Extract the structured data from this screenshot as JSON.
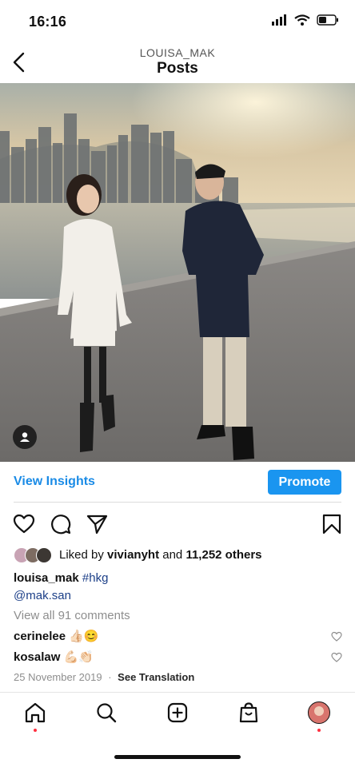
{
  "status": {
    "time": "16:16"
  },
  "header": {
    "username": "LOUISA_MAK",
    "title": "Posts"
  },
  "post": {
    "insights_label": "View Insights",
    "promote_label": "Promote",
    "likes": {
      "prefix": "Liked by ",
      "user": "vivianyht",
      "middle": " and ",
      "count": "11,252 others"
    },
    "caption": {
      "username": "louisa_mak",
      "hashtag": "#hkg",
      "mention": "@mak.san"
    },
    "view_all_comments": "View all 91 comments",
    "comments": [
      {
        "username": "cerinelee",
        "text": "👍🏻😊"
      },
      {
        "username": "kosalaw",
        "text": "💪🏻👏🏻"
      }
    ],
    "date": "25 November 2019",
    "separator": "·",
    "see_translation": "See Translation"
  },
  "colors": {
    "link_blue": "#1a8be6",
    "promote_bg": "#1a95f0",
    "hashtag": "#1c3f88",
    "notification_dot": "#ff3040"
  },
  "icons": [
    "back-icon",
    "heart-icon",
    "comment-icon",
    "share-icon",
    "bookmark-icon",
    "home-icon",
    "search-icon",
    "new-post-icon",
    "shop-icon",
    "profile-icon",
    "user-tag-icon"
  ]
}
